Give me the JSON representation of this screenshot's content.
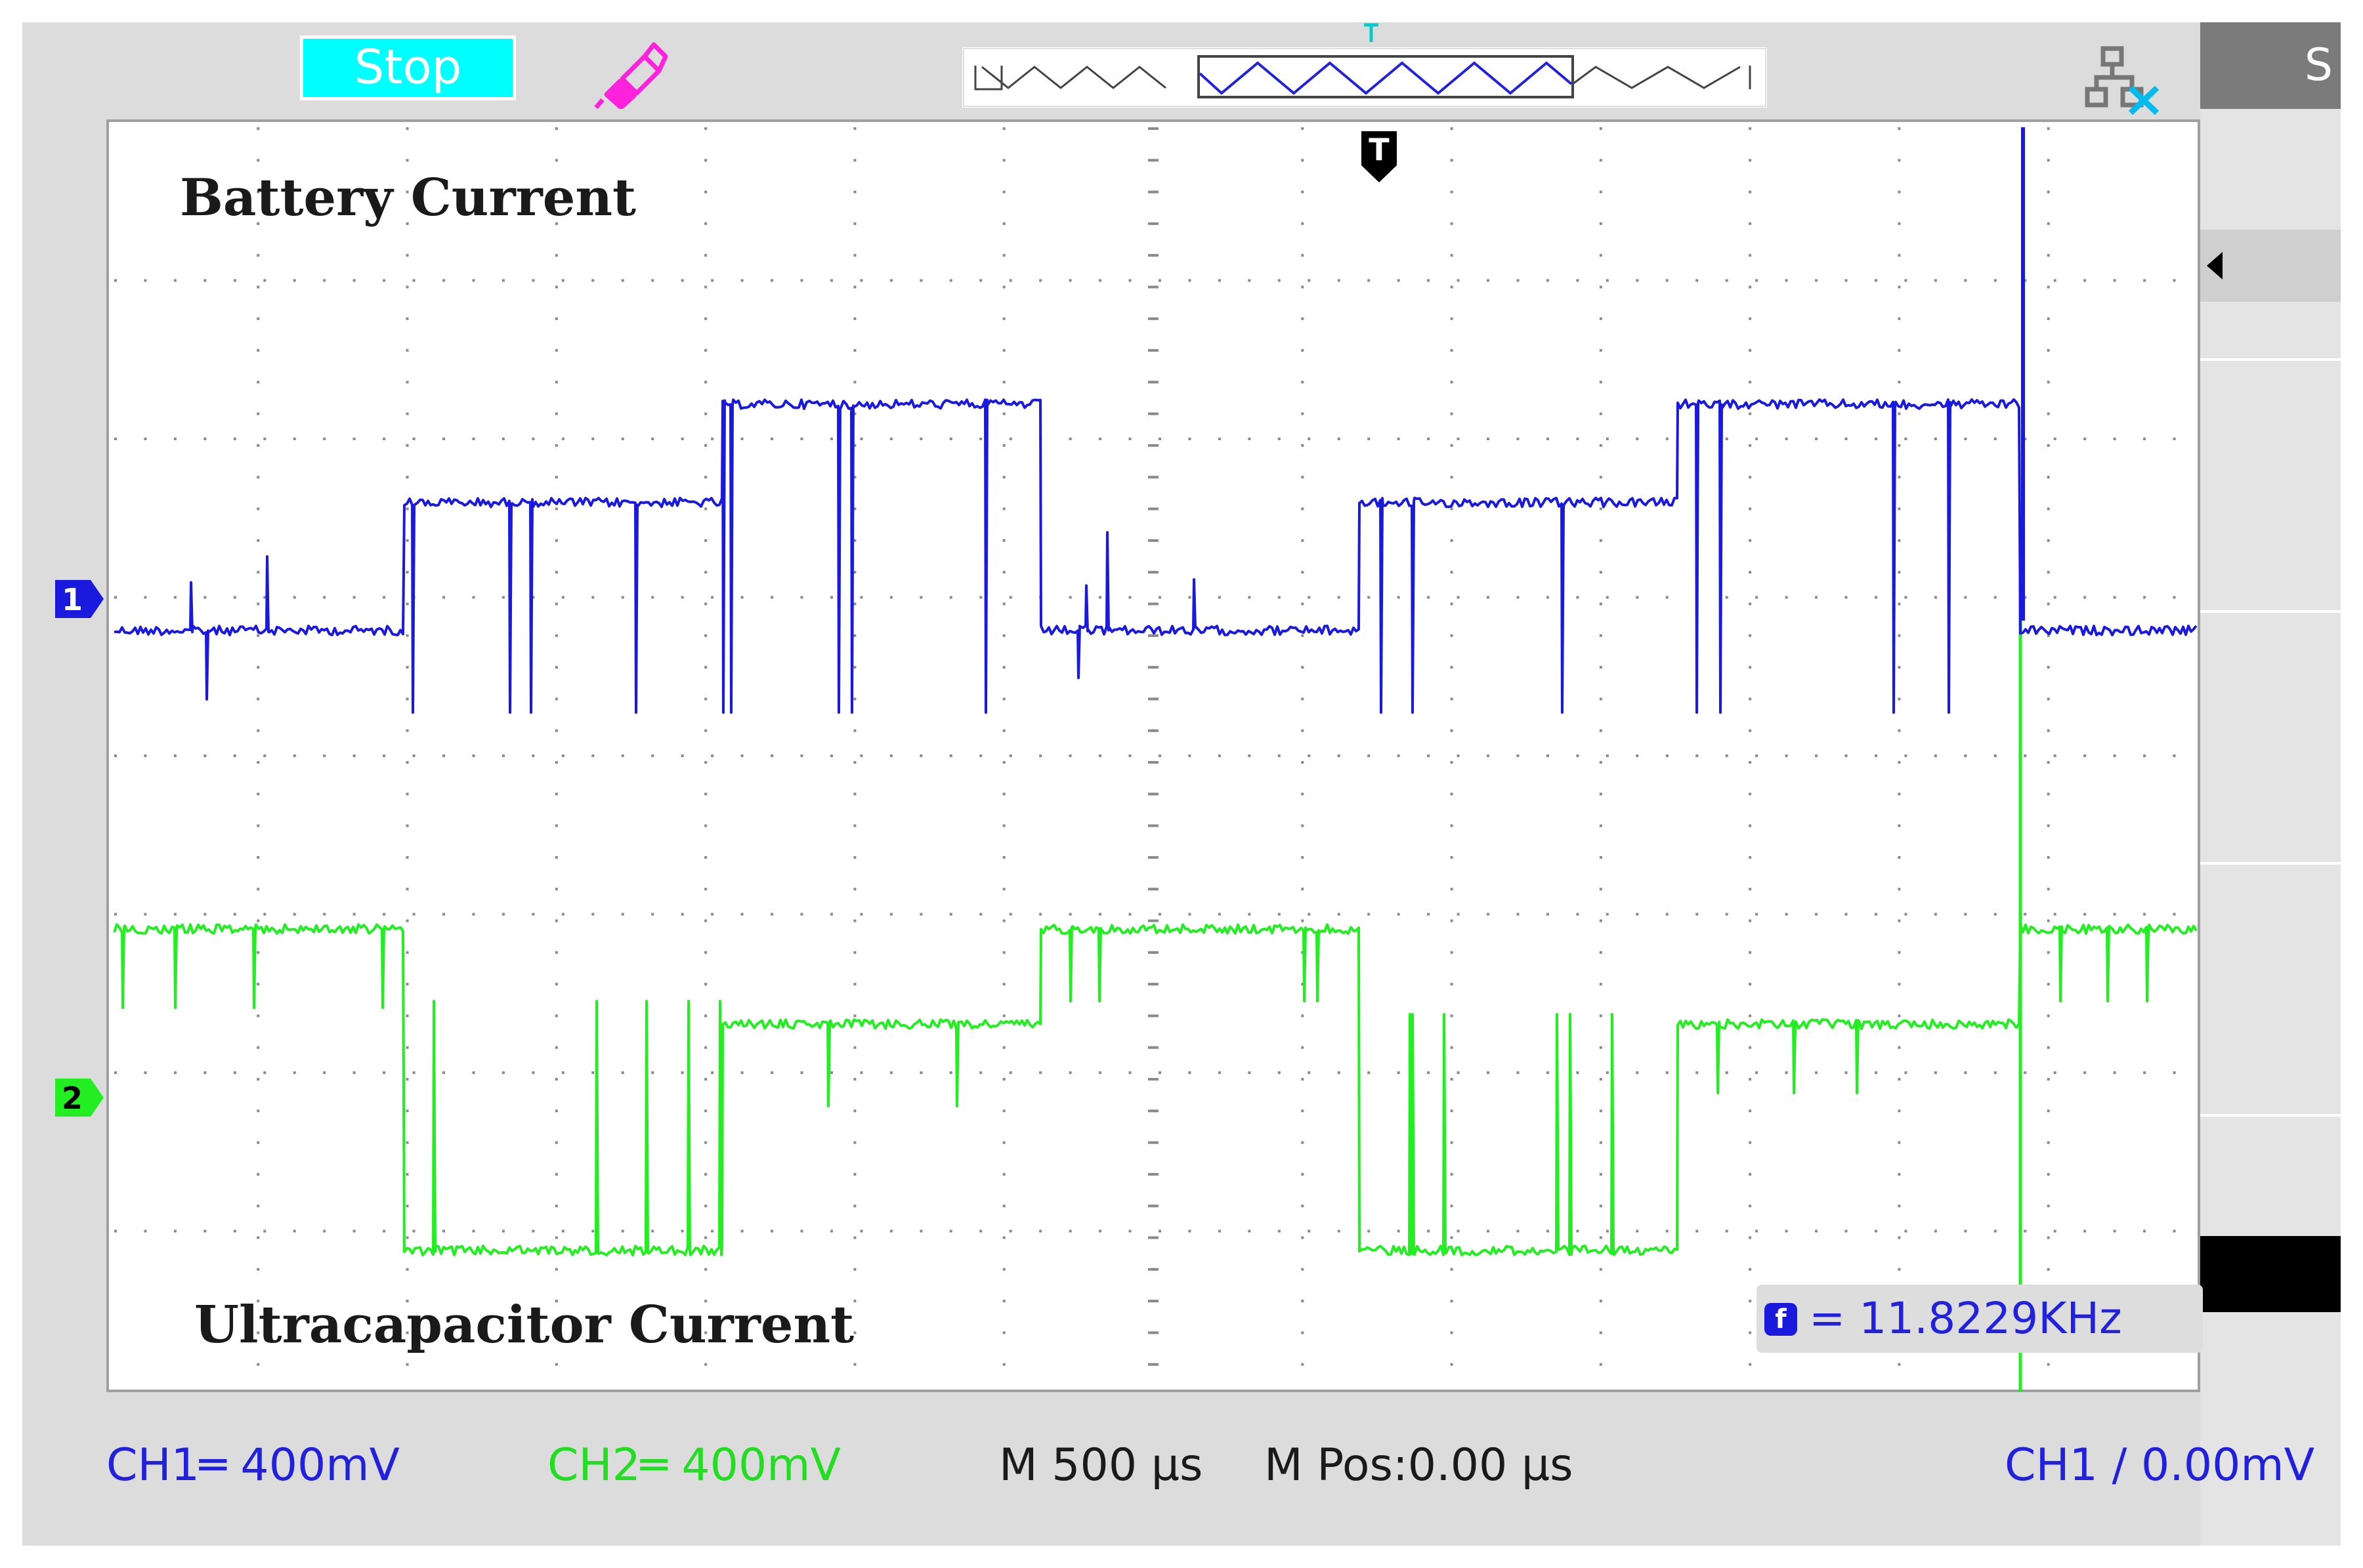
{
  "toolbar": {
    "run_state_label": "Stop",
    "probe_icon": "probe-icon",
    "network_icon": "network-icon",
    "trigger_marker": "T"
  },
  "softkeys": {
    "top_label": "S",
    "arrow_icon": "triangle-left-icon"
  },
  "screen": {
    "labels": {
      "battery": "Battery Current",
      "ultracapacitor": "Ultracapacitor Current"
    },
    "frequency_readout": {
      "icon_glyph": "f",
      "text": "= 11.8229KHz"
    },
    "channel_markers": [
      {
        "label": "1",
        "color": "#1a1adf"
      },
      {
        "label": "2",
        "color": "#22dd22"
      }
    ]
  },
  "status": {
    "ch1_scale": "CH1═ 400mV",
    "ch2_scale": "CH2═ 400mV",
    "timebase": "M 500 µs",
    "mpos": "M Pos:0.00 µs",
    "trigger": "CH1 ∕ 0.00mV"
  },
  "colors": {
    "ch1": "#1a1adf",
    "ch2": "#22ee22",
    "run_state_bg": "#00ffff",
    "probe": "#ff22dd"
  }
}
